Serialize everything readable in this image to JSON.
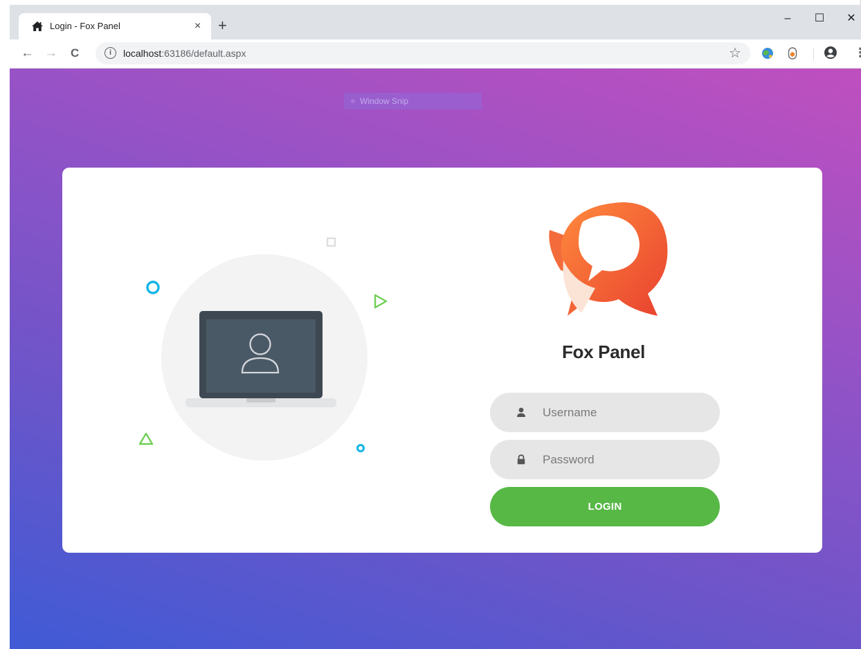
{
  "browser": {
    "tab": {
      "title": "Login - Fox Panel",
      "close_glyph": "×",
      "favicon": "home-icon"
    },
    "new_tab_glyph": "+",
    "window_controls": {
      "minimize": "–",
      "maximize": "☐",
      "close": "✕"
    },
    "nav": {
      "back": "←",
      "forward": "→",
      "reload": "C"
    },
    "address": {
      "host": "localhost",
      "rest": ":63186/default.aspx",
      "info_glyph": "i"
    },
    "star_glyph": "☆",
    "menu_glyph": "⋮"
  },
  "overlay": {
    "snip_label": "Window Snip"
  },
  "login": {
    "brand_name": "Fox Panel",
    "username_placeholder": "Username",
    "password_placeholder": "Password",
    "login_label": "LOGIN"
  },
  "colors": {
    "accent_green": "#57b846",
    "field_bg": "#e6e6e6",
    "gradient_start": "#3f5bd5",
    "gradient_end": "#c04fbf"
  }
}
